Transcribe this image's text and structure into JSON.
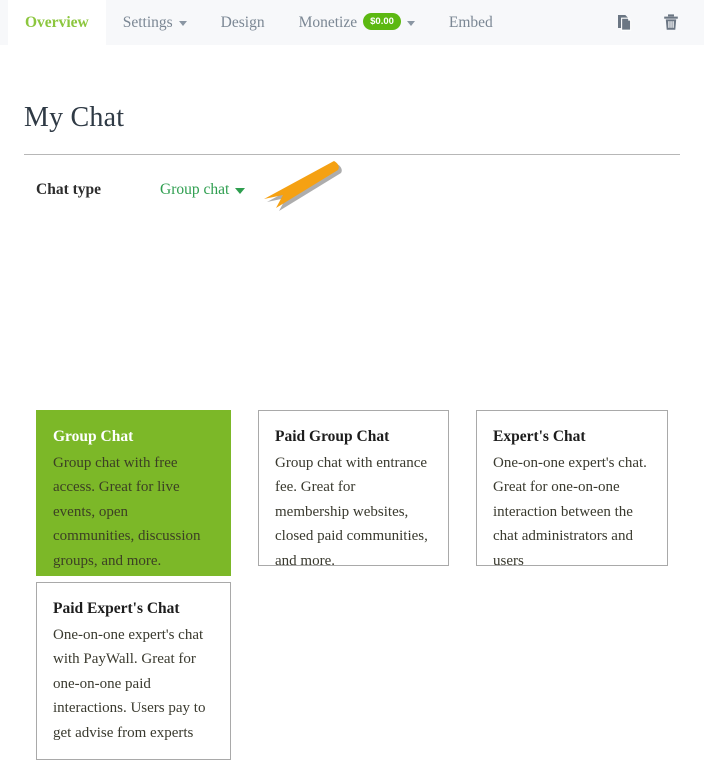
{
  "tabs": [
    {
      "label": "Overview",
      "active": true,
      "has_caret": false,
      "badge": null
    },
    {
      "label": "Settings",
      "active": false,
      "has_caret": true,
      "badge": null
    },
    {
      "label": "Design",
      "active": false,
      "has_caret": false,
      "badge": null
    },
    {
      "label": "Monetize",
      "active": false,
      "has_caret": true,
      "badge": "$0.00"
    },
    {
      "label": "Embed",
      "active": false,
      "has_caret": false,
      "badge": null
    }
  ],
  "tab_actions": [
    {
      "name": "duplicate-icon",
      "title": "Duplicate"
    },
    {
      "name": "delete-icon",
      "title": "Delete"
    }
  ],
  "page": {
    "title": "My Chat"
  },
  "chat_type": {
    "label": "Chat type",
    "value": "Group chat",
    "options": [
      "Group chat",
      "Paid group chat",
      "Expert's chat",
      "Paid expert's chat"
    ]
  },
  "annotation": {
    "type": "arrow",
    "color": "#F5A113",
    "points_to": "chat-type-dropdown"
  },
  "cards": [
    {
      "title": "Group Chat",
      "description": "Group chat with free access. Great for live events, open communities, discussion groups, and more.",
      "selected": true
    },
    {
      "title": "Paid Group Chat",
      "description": "Group chat with entrance fee. Great for membership websites, closed paid communities, and more.",
      "selected": false
    },
    {
      "title": "Expert's Chat",
      "description": "One-on-one expert's chat. Great for one-on-one interaction between the chat administrators and users",
      "selected": false
    },
    {
      "title": "Paid Expert's Chat",
      "description": "One-on-one expert's chat with PayWall. Great for one-on-one paid interactions. Users pay to get advise from experts",
      "selected": false
    }
  ],
  "colors": {
    "accent_green": "#7cb828",
    "tab_active_green": "#8cc63e",
    "badge_green": "#5cb811",
    "dropdown_green": "#2e9e4f",
    "arrow_orange": "#F5A113",
    "tabbar_bg": "#f7f8fa"
  }
}
